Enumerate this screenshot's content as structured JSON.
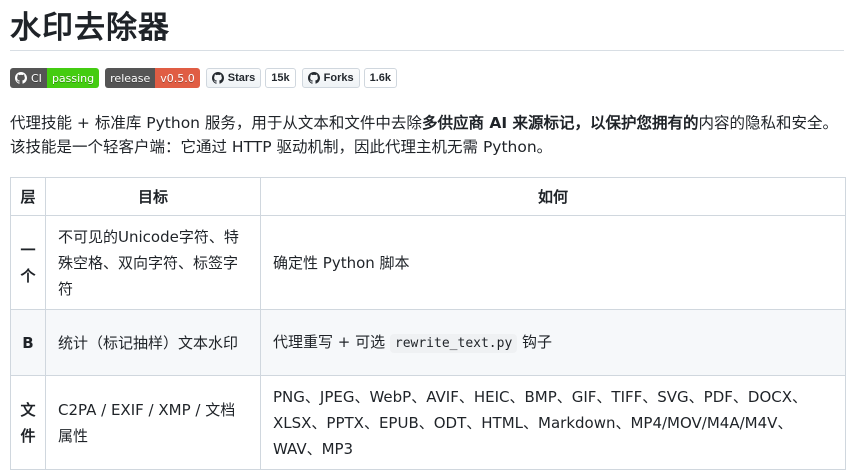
{
  "page": {
    "title": "水印去除器"
  },
  "badges": {
    "ci": {
      "icon": "github-icon",
      "label": "CI",
      "value": "passing",
      "color": "#44cc11"
    },
    "release": {
      "label": "release",
      "value": "v0.5.0",
      "color": "#e05d44"
    },
    "stars": {
      "icon": "github-icon",
      "label": "Stars",
      "count": "15k"
    },
    "forks": {
      "icon": "github-icon",
      "label": "Forks",
      "count": "1.6k"
    }
  },
  "intro": {
    "line1_a": "代理技能 + 标准库 Python 服务，用于从文本和文件中去除",
    "line1_bold": "多供应商 AI 来源标记，以保护您拥有的",
    "line1_b": "内容的隐私和安全。",
    "line2": "该技能是一个轻客户端：它通过 HTTP 驱动机制，因此代理主机无需 Python。"
  },
  "table": {
    "headers": [
      "层",
      "目标",
      "如何"
    ],
    "rows": [
      {
        "layer": "一\n个",
        "goal": "不可见的Unicode字符、特殊空格、双向字符、标签字符",
        "how": "确定性 Python 脚本"
      },
      {
        "layer": "B",
        "goal": "统计（标记抽样）文本水印",
        "how_a": "代理重写 + 可选 ",
        "how_code": "rewrite_text.py",
        "how_b": " 钩子"
      },
      {
        "layer": "文\n件",
        "goal": "C2PA / EXIF / XMP / 文档属性",
        "how": "PNG、JPEG、WebP、AVIF、HEIC、BMP、GIF、TIFF、SVG、PDF、DOCX、XLSX、PPTX、EPUB、ODT、HTML、Markdown、MP4/MOV/M4A/M4V、WAV、MP3"
      }
    ]
  }
}
